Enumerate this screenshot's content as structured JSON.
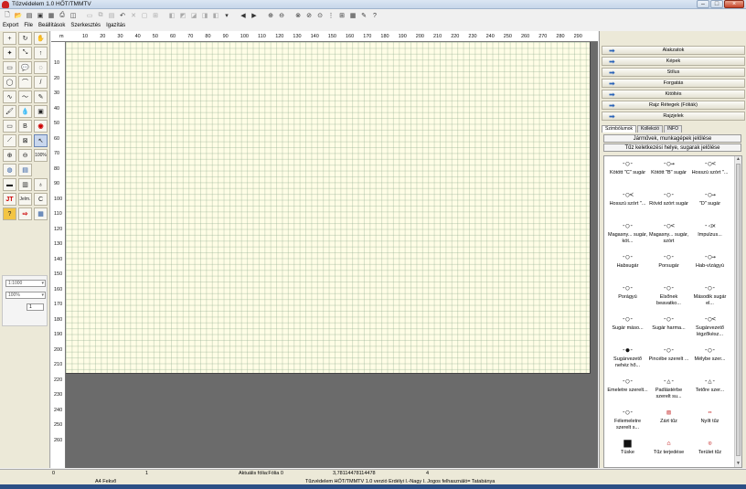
{
  "window": {
    "title": "Tűzvédelem 1.0 HŐT/TMMTV"
  },
  "toolbar_icons": [
    "new-icon",
    "open-icon",
    "folder-icon",
    "save-icon",
    "print-preview-icon",
    "print-icon",
    "preview-icon",
    "cut-icon",
    "copy-icon",
    "paste-icon",
    "undo-icon",
    "delete-icon",
    "duplicate-icon",
    "group-icon",
    "ungroup-icon",
    "bring-front-icon",
    "send-back-icon",
    "flip-h-icon",
    "flip-v-icon",
    "align-icon",
    "import-icon",
    "zoom-in-icon",
    "zoom-out-icon",
    "zoom-area-icon",
    "grid-icon",
    "snap-icon",
    "zoom-fit-icon",
    "zoom-page-icon",
    "table-icon",
    "settings-icon",
    "help-icon"
  ],
  "menu": [
    "Export",
    "File",
    "Beállítások",
    "Szerkesztés",
    "Igazítás"
  ],
  "left_tools": {
    "zoom_label": "100%",
    "jelm_label": "Jelm.",
    "c_label": "C"
  },
  "scale": {
    "scale_value": "1:1000",
    "zoom_value": "100%",
    "number_value": "1"
  },
  "ruler": {
    "corner": "m",
    "h_marks": [
      "10",
      "20",
      "30",
      "40",
      "50",
      "60",
      "70",
      "80",
      "90",
      "100",
      "110",
      "120",
      "130",
      "140",
      "150",
      "160",
      "170",
      "180",
      "190",
      "200",
      "210",
      "220",
      "230",
      "240",
      "250",
      "260",
      "270",
      "280",
      "290"
    ],
    "v_marks": [
      "10",
      "20",
      "30",
      "40",
      "50",
      "60",
      "70",
      "80",
      "90",
      "100",
      "110",
      "120",
      "130",
      "140",
      "150",
      "160",
      "170",
      "180",
      "190",
      "200",
      "210",
      "220",
      "230",
      "240",
      "250",
      "260"
    ]
  },
  "panel": {
    "sections": [
      "Alakzatok",
      "Képek",
      "Stílus",
      "Forgatás",
      "Kitöltés",
      "Rajz Rétegek (Fóliák)",
      "Rajzjelek"
    ],
    "tabs": [
      "Szimbólumok",
      "Kollekció",
      "INFO"
    ],
    "category": "Járművek, munkagépek jelölése",
    "subcategory": "Tűz keletkezési helye, sugarak jelölése",
    "symbols": [
      {
        "label": "Kötött \"C\" sugár",
        "glyph": "-○-"
      },
      {
        "label": "Kötött \"B\" sugár",
        "glyph": "-○→"
      },
      {
        "label": "Hosszú szórt \"...",
        "glyph": "-○<"
      },
      {
        "label": "Hosszú szórt \"...",
        "glyph": "-○≺"
      },
      {
        "label": "Rövid szórt sugár",
        "glyph": "-○-"
      },
      {
        "label": "\"D\" sugár",
        "glyph": "-○→"
      },
      {
        "label": "Magasny... sugár, köt...",
        "glyph": "-○-"
      },
      {
        "label": "Magasny... sugár, szórt",
        "glyph": "-○<"
      },
      {
        "label": "Impulzus...",
        "glyph": "-◁✕"
      },
      {
        "label": "Habsugár",
        "glyph": "-○-"
      },
      {
        "label": "Porsugár",
        "glyph": "-○-"
      },
      {
        "label": "Hab-vízágyú",
        "glyph": "-○→"
      },
      {
        "label": "Porágyú",
        "glyph": "-○-"
      },
      {
        "label": "Elsőnek beavatko...",
        "glyph": "-○-"
      },
      {
        "label": "Második sugár el...",
        "glyph": "-○-"
      },
      {
        "label": "Sugár máso...",
        "glyph": "-○-"
      },
      {
        "label": "Sugár harma...",
        "glyph": "-○-"
      },
      {
        "label": "Sugárvezető légzőkész...",
        "glyph": "-○<"
      },
      {
        "label": "Sugárvezető nehéz hő...",
        "glyph": "-●-"
      },
      {
        "label": "Pincébe szerelt ...",
        "glyph": "-○-"
      },
      {
        "label": "Mélybe szer...",
        "glyph": "-○-"
      },
      {
        "label": "Emeletre szerelt...",
        "glyph": "-○-"
      },
      {
        "label": "Padlástérbe szerelt su...",
        "glyph": "-△-"
      },
      {
        "label": "Tetőre szer...",
        "glyph": "-△-"
      },
      {
        "label": "Félemeletre szerelt s...",
        "glyph": "-○-"
      },
      {
        "label": "Zárt tűz",
        "glyph": "▨"
      },
      {
        "label": "Nyílt tűz",
        "glyph": "⇔"
      },
      {
        "label": "Tüske",
        "glyph": "■"
      },
      {
        "label": "Tűz terjedése",
        "glyph": "⌂"
      },
      {
        "label": "Terület tűz",
        "glyph": "⊙"
      }
    ]
  },
  "status": {
    "left_index": "0",
    "paper": "A4 Fekvő",
    "layer_num": "1",
    "active_layer": "Aktuális fólia:Fólia 0",
    "value": "3,78114478114478",
    "count": "4",
    "footer": "Tűzvédelem HŐT/TMMTV 1.0 verzió Erdélyi I.-Nagy I.   Jogos felhasználó= Tatabánya"
  },
  "colors": {
    "paper": "#fffde6",
    "accent_arrow": "#2a63b8",
    "work_bg": "#6b6b6b"
  }
}
